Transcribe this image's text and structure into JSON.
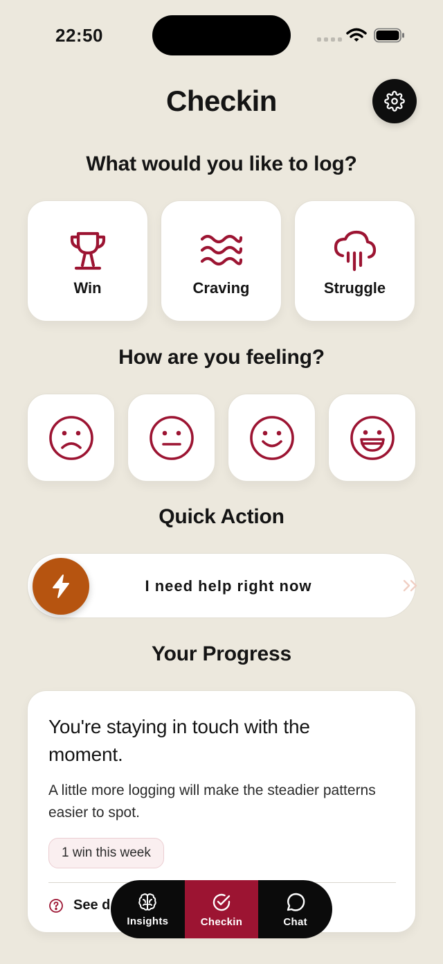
{
  "status_bar": {
    "time": "22:50"
  },
  "header": {
    "title": "Checkin",
    "settings_icon": "gear-icon"
  },
  "log_section": {
    "title": "What would you like to log?",
    "options": [
      {
        "label": "Win",
        "icon": "trophy-icon"
      },
      {
        "label": "Craving",
        "icon": "waves-icon"
      },
      {
        "label": "Struggle",
        "icon": "rain-cloud-icon"
      }
    ]
  },
  "mood_section": {
    "title": "How are you feeling?",
    "options": [
      "sad-face-icon",
      "neutral-face-icon",
      "smile-face-icon",
      "laughing-face-icon"
    ]
  },
  "quick_action": {
    "title": "Quick Action",
    "label": "I need help right now",
    "icon": "bolt-icon"
  },
  "progress": {
    "title": "Your Progress",
    "heading": "You're staying in touch with the moment.",
    "body": "A little more logging will make the steadier patterns easier to spot.",
    "badge": "1 win this week",
    "link_label": "See d"
  },
  "tabbar": {
    "tabs": [
      {
        "label": "Insights",
        "icon": "brain-icon"
      },
      {
        "label": "Checkin",
        "icon": "check-circle-icon",
        "active": true
      },
      {
        "label": "Chat",
        "icon": "chat-bubble-icon"
      }
    ]
  },
  "colors": {
    "background": "#ECE8DD",
    "accent": "#9C1432",
    "bolt": "#B65410",
    "dark": "#0B0B0B"
  }
}
